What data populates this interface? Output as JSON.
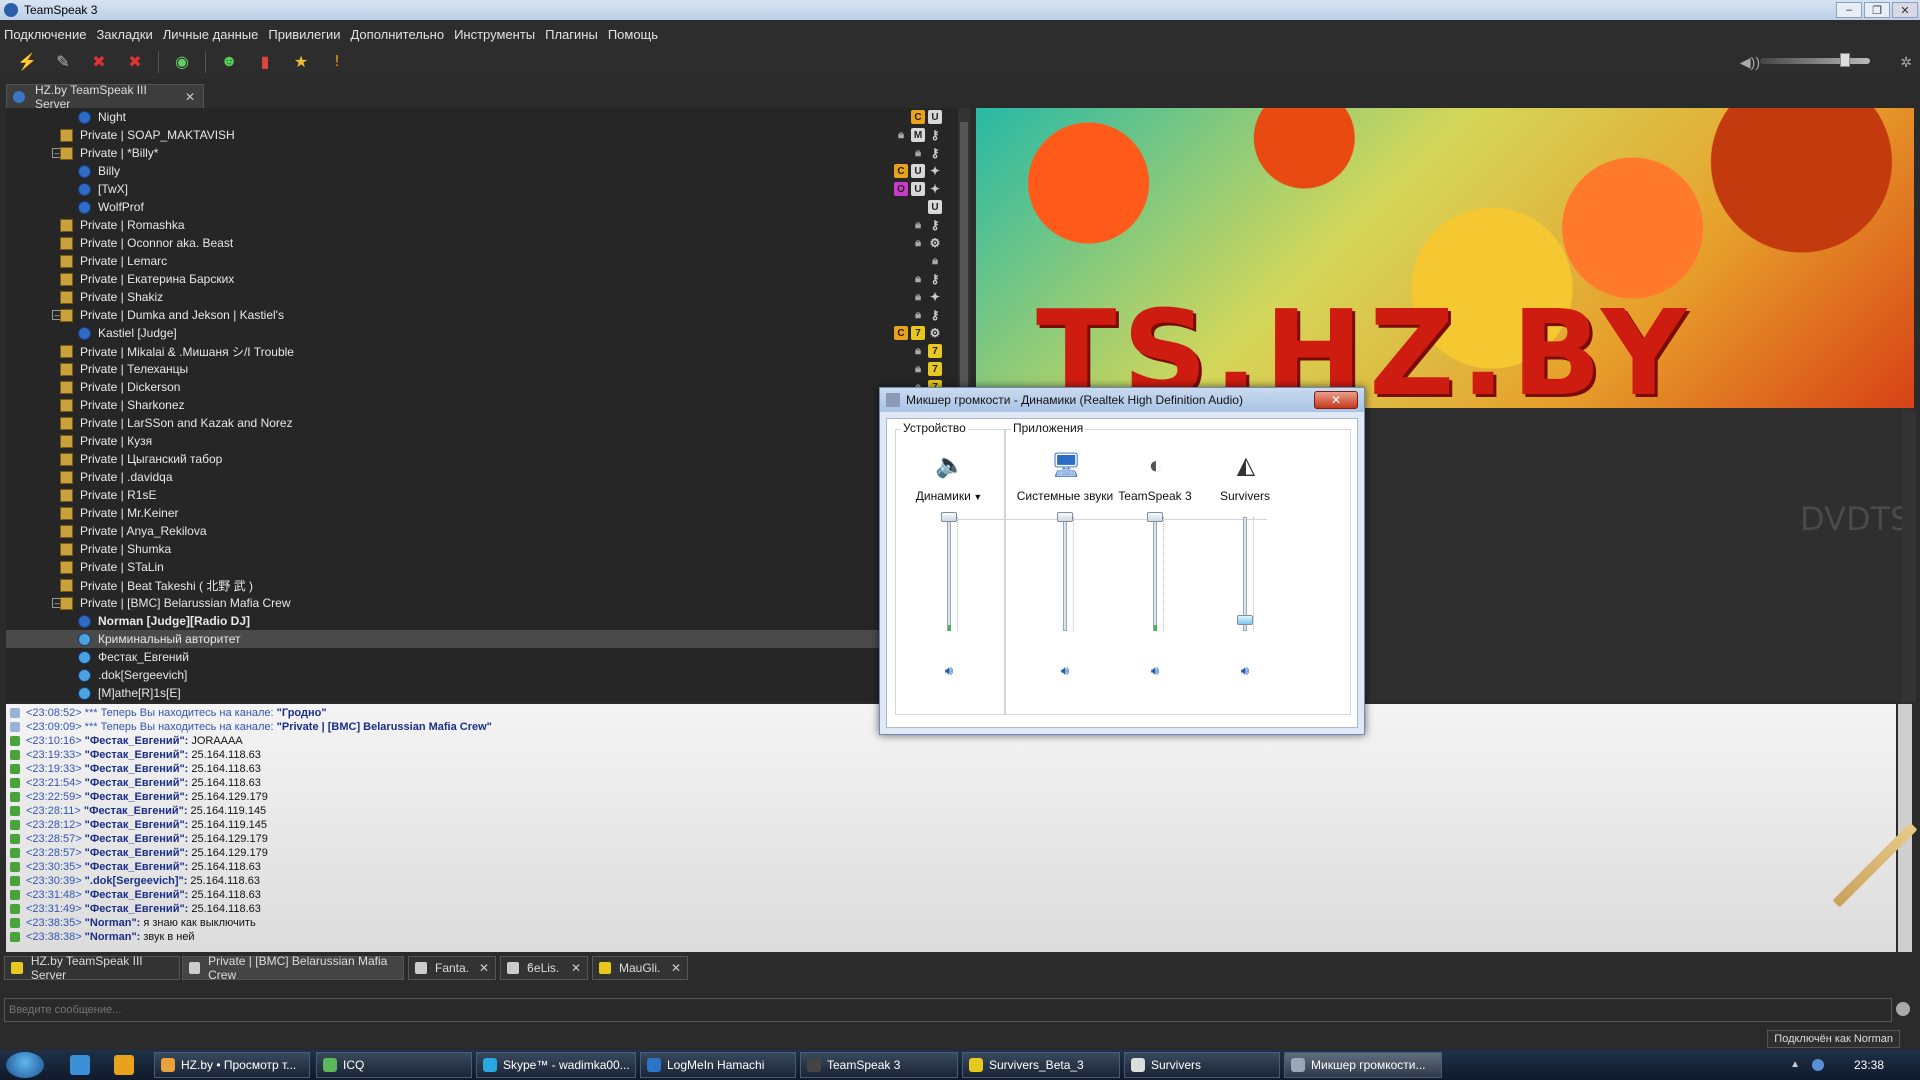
{
  "window": {
    "title": "TeamSpeak 3",
    "controls": [
      "–",
      "❐",
      "✕"
    ]
  },
  "menu": [
    "Подключение",
    "Закладки",
    "Личные данные",
    "Привилегии",
    "Дополнительно",
    "Инструменты",
    "Плагины",
    "Помощь"
  ],
  "server_tab": {
    "label": "HZ.by TeamSpeak III Server",
    "close": "✕"
  },
  "tree": [
    {
      "label": "Night",
      "kind": "user",
      "depth": 2,
      "badges": [
        "C",
        "U"
      ]
    },
    {
      "label": "Private | SOAP_MAKTAVISH",
      "kind": "channel",
      "depth": 1,
      "badges": [
        "lock",
        "M",
        "key"
      ]
    },
    {
      "label": "Private | *Billy*",
      "kind": "channel",
      "depth": 1,
      "expanded": true,
      "badges": [
        "lock",
        "key"
      ]
    },
    {
      "label": "Billy",
      "kind": "user",
      "depth": 2,
      "badges": [
        "C",
        "U",
        "misc"
      ]
    },
    {
      "label": "[TwX]",
      "kind": "user",
      "depth": 2,
      "badges": [
        "O",
        "U",
        "misc"
      ]
    },
    {
      "label": "WolfProf",
      "kind": "user",
      "depth": 2,
      "badges": [
        "U"
      ]
    },
    {
      "label": "Private | Romashka",
      "kind": "channel",
      "depth": 1,
      "badges": [
        "lock",
        "key"
      ]
    },
    {
      "label": "Private | Oconnor aka. Beast",
      "kind": "channel",
      "depth": 1,
      "badges": [
        "lock",
        "gear"
      ]
    },
    {
      "label": "Private | Lemarc",
      "kind": "channel",
      "depth": 1,
      "badges": [
        "lock"
      ]
    },
    {
      "label": "Private | Екатерина Барских",
      "kind": "channel",
      "depth": 1,
      "badges": [
        "lock",
        "key"
      ]
    },
    {
      "label": "Private | Shakiz",
      "kind": "channel",
      "depth": 1,
      "badges": [
        "lock",
        "misc"
      ]
    },
    {
      "label": "Private | Dumka and Jekson | Kastiel's",
      "kind": "channel",
      "depth": 1,
      "expanded": true,
      "badges": [
        "lock",
        "key"
      ]
    },
    {
      "label": "Kastiel [Judge]",
      "kind": "user",
      "depth": 2,
      "badges": [
        "C",
        "7",
        "gear"
      ]
    },
    {
      "label": "Private | Mikalai  & .Мишаня シ/I Trouble",
      "kind": "channel",
      "depth": 1,
      "badges": [
        "lock",
        "7"
      ]
    },
    {
      "label": "Private | Телеханцы",
      "kind": "channel",
      "depth": 1,
      "badges": [
        "lock",
        "7"
      ]
    },
    {
      "label": "Private | Dickerson",
      "kind": "channel",
      "depth": 1,
      "badges": [
        "lock",
        "7"
      ]
    },
    {
      "label": "Private | Sharkonez",
      "kind": "channel",
      "depth": 1,
      "badges": []
    },
    {
      "label": "Private | LarSSon and Kazak and Norez",
      "kind": "channel",
      "depth": 1,
      "badges": []
    },
    {
      "label": "Private | Кузя",
      "kind": "channel",
      "depth": 1,
      "badges": []
    },
    {
      "label": "Private | Цыганский табор",
      "kind": "channel",
      "depth": 1,
      "badges": []
    },
    {
      "label": "Private | .davidqa",
      "kind": "channel",
      "depth": 1,
      "badges": []
    },
    {
      "label": "Private | R1sE",
      "kind": "channel",
      "depth": 1,
      "badges": []
    },
    {
      "label": "Private | Mr.Keiner",
      "kind": "channel",
      "depth": 1,
      "badges": []
    },
    {
      "label": "Private | Anya_Rekilova",
      "kind": "channel",
      "depth": 1,
      "badges": []
    },
    {
      "label": "Private | Shumka",
      "kind": "channel",
      "depth": 1,
      "badges": []
    },
    {
      "label": "Private | STaLin",
      "kind": "channel",
      "depth": 1,
      "badges": []
    },
    {
      "label": "Private | Beat Takeshi ( 北野 武 )",
      "kind": "channel",
      "depth": 1,
      "badges": []
    },
    {
      "label": "Private | [BMC] Belarussian Mafia Crew",
      "kind": "channel",
      "depth": 1,
      "expanded": true,
      "badges": []
    },
    {
      "label": "Norman [Judge][Radio DJ]",
      "kind": "user",
      "depth": 2,
      "bold": true,
      "badges": [
        "C",
        "M",
        "7"
      ]
    },
    {
      "label": "Криминальный авторитет",
      "kind": "user",
      "depth": 2,
      "selected": true,
      "badges": []
    },
    {
      "label": "Фестак_Евгений",
      "kind": "user",
      "depth": 2,
      "badges": []
    },
    {
      "label": ".dok[Sergeevich]",
      "kind": "user",
      "depth": 2,
      "badges": []
    },
    {
      "label": "[M]athe[R]1s[E]",
      "kind": "user",
      "depth": 2,
      "badges": []
    }
  ],
  "banner": {
    "text": "TS.HZ.BY",
    "watermark": "DVDTS"
  },
  "chat": [
    {
      "ts": "<23:08:52>",
      "type": "sys",
      "text": "*** Теперь Вы находитесь на канале: ",
      "chan": "\"Гродно\""
    },
    {
      "ts": "<23:09:09>",
      "type": "sys",
      "text": "*** Теперь Вы находитесь на канале: ",
      "chan": "\"Private | [BMC] Belarussian Mafia Crew\""
    },
    {
      "ts": "<23:10:16>",
      "type": "msg",
      "nick": "\"Фестак_Евгений\":",
      "text": "JORAAAA"
    },
    {
      "ts": "<23:19:33>",
      "type": "msg",
      "nick": "\"Фестак_Евгений\":",
      "text": "25.164.118.63"
    },
    {
      "ts": "<23:19:33>",
      "type": "msg",
      "nick": "\"Фестак_Евгений\":",
      "text": "25.164.118.63"
    },
    {
      "ts": "<23:21:54>",
      "type": "msg",
      "nick": "\"Фестак_Евгений\":",
      "text": "25.164.118.63"
    },
    {
      "ts": "<23:22:59>",
      "type": "msg",
      "nick": "\"Фестак_Евгений\":",
      "text": "25.164.129.179"
    },
    {
      "ts": "<23:28:11>",
      "type": "msg",
      "nick": "\"Фестак_Евгений\":",
      "text": "25.164.119.145"
    },
    {
      "ts": "<23:28:12>",
      "type": "msg",
      "nick": "\"Фестак_Евгений\":",
      "text": "25.164.119.145"
    },
    {
      "ts": "<23:28:57>",
      "type": "msg",
      "nick": "\"Фестак_Евгений\":",
      "text": "25.164.129.179"
    },
    {
      "ts": "<23:28:57>",
      "type": "msg",
      "nick": "\"Фестак_Евгений\":",
      "text": "25.164.129.179"
    },
    {
      "ts": "<23:30:35>",
      "type": "msg",
      "nick": "\"Фестак_Евгений\":",
      "text": "25.164.118.63"
    },
    {
      "ts": "<23:30:39>",
      "type": "msg",
      "nick": "\".dok[Sergeevich]\":",
      "text": "25.164.118.63"
    },
    {
      "ts": "<23:31:48>",
      "type": "msg",
      "nick": "\"Фестак_Евгений\":",
      "text": "25.164.118.63"
    },
    {
      "ts": "<23:31:49>",
      "type": "msg",
      "nick": "\"Фестак_Евгений\":",
      "text": "25.164.118.63"
    },
    {
      "ts": "<23:38:35>",
      "type": "msg",
      "nick": "\"Norman\":",
      "text": "я знаю как выключить"
    },
    {
      "ts": "<23:38:38>",
      "type": "msg",
      "nick": "\"Norman\":",
      "text": "звук в ней"
    }
  ],
  "chat_tabs": [
    {
      "label": "HZ.by TeamSpeak III Server",
      "closable": false
    },
    {
      "label": "Private | [BMC] Belarussian Mafia Crew",
      "closable": false,
      "active": true
    },
    {
      "label": "Fanta.",
      "closable": true
    },
    {
      "label": "ϐeLis.",
      "closable": true
    },
    {
      "label": "MauGli.",
      "closable": true
    }
  ],
  "message_input": {
    "placeholder": "Введите сообщение..."
  },
  "status": {
    "connected_as": "Подключён как Norman"
  },
  "mixer": {
    "title": "Микшер громкости - Динамики (Realtek High Definition Audio)",
    "close": "✕",
    "device_group": "Устройство",
    "apps_group": "Приложения",
    "channels": [
      {
        "name": "Динамики",
        "icon": "speaker-device-icon",
        "volume": 1.0,
        "level": 0.05,
        "dropdown": true
      },
      {
        "name": "Системные звуки",
        "icon": "system-sounds-icon",
        "volume": 1.0,
        "level": 0.0
      },
      {
        "name": "TeamSpeak 3",
        "icon": "teamspeak-icon",
        "volume": 1.0,
        "level": 0.05
      },
      {
        "name": "Survivers",
        "icon": "unity-icon",
        "volume": 0.1,
        "level": 0.0
      }
    ]
  },
  "taskbar": {
    "tasks": [
      {
        "label": "HZ.by • Просмотр т..."
      },
      {
        "label": "ICQ"
      },
      {
        "label": "Skype™ - wadimka00..."
      },
      {
        "label": "LogMeIn Hamachi"
      },
      {
        "label": "TeamSpeak 3"
      },
      {
        "label": "Survivers_Beta_3"
      },
      {
        "label": "Survivers"
      },
      {
        "label": "Микшер громкости...",
        "active": true
      }
    ],
    "clock": "23:38"
  }
}
